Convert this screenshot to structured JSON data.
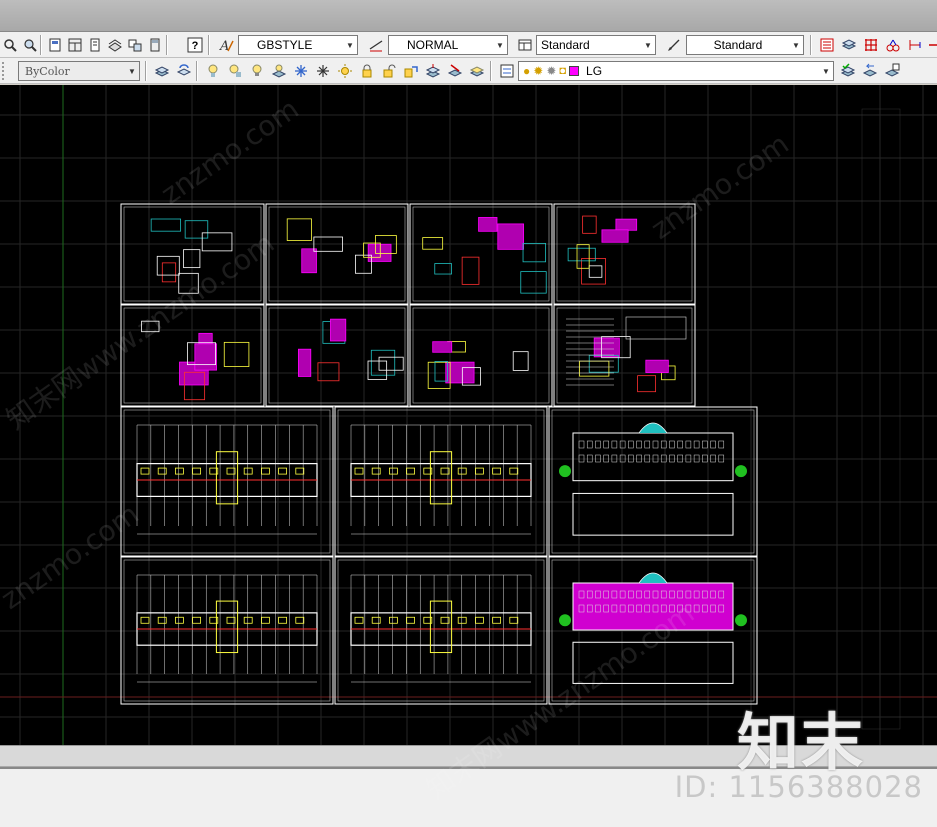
{
  "toolbar1": {
    "text_style": "GBSTYLE",
    "dim_style": "NORMAL",
    "table_style": "Standard",
    "multileader_style": "Standard"
  },
  "toolbar2": {
    "color_control": "ByColor",
    "layer_name": "LG",
    "layer_color": "#ff00ff"
  },
  "drawing": {
    "background": "#000000",
    "sheets": [
      {
        "id": "detail-sheet"
      },
      {
        "id": "stair-sheet"
      },
      {
        "id": "plan-detail-sheet"
      },
      {
        "id": "section-detail-sheet"
      },
      {
        "id": "wall-detail-sheet"
      },
      {
        "id": "wall-detail-sheet-2"
      },
      {
        "id": "elevation-small-sheet"
      },
      {
        "id": "notes-sheet"
      },
      {
        "id": "floor-plan-1"
      },
      {
        "id": "floor-plan-2"
      },
      {
        "id": "elevation-sheet-1"
      },
      {
        "id": "floor-plan-3"
      },
      {
        "id": "floor-plan-4"
      },
      {
        "id": "elevation-section-sheet"
      }
    ]
  },
  "watermark": {
    "site": "znzmo.com",
    "logo": "知末",
    "id_text": "ID: 1156388028",
    "cn_site": "知末网www.znzmo.com"
  }
}
